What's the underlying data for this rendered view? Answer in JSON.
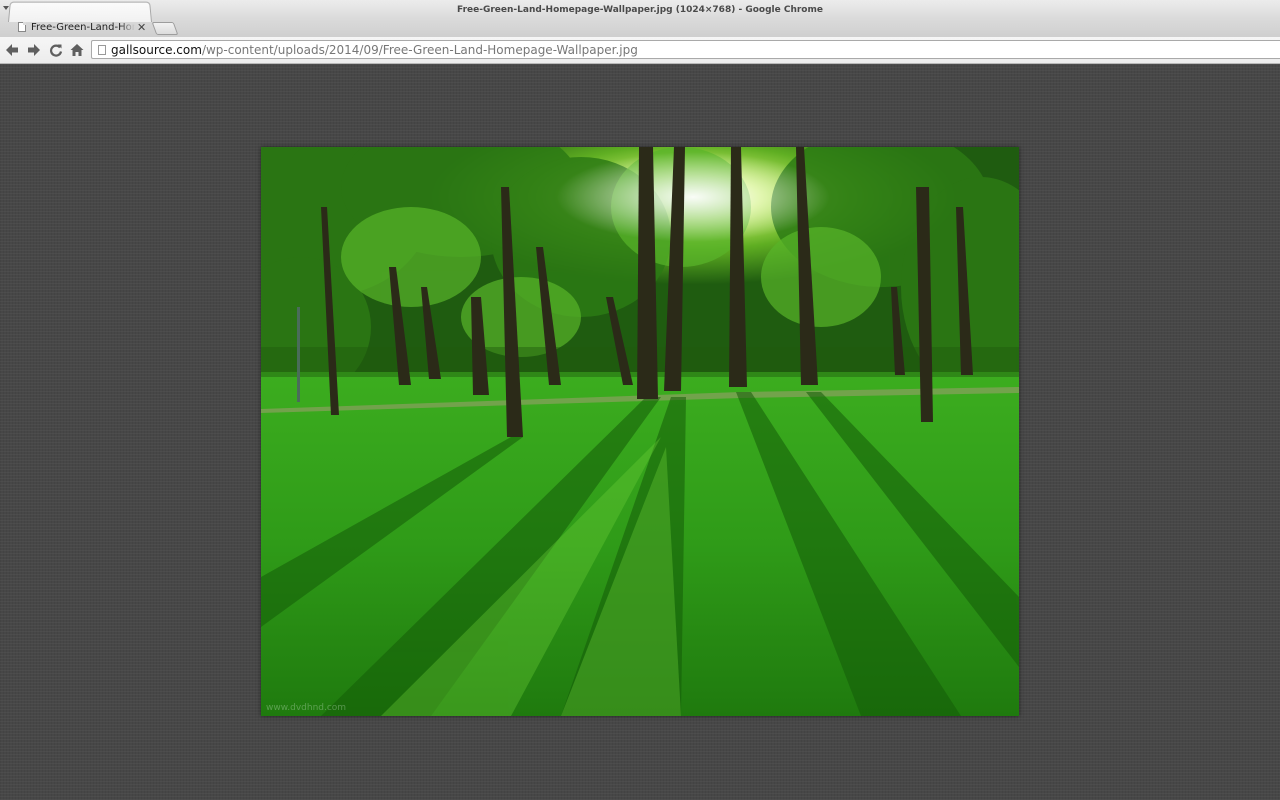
{
  "window": {
    "title": "Free-Green-Land-Homepage-Wallpaper.jpg (1024×768) - Google Chrome"
  },
  "tabs": [
    {
      "label": "Free-Green-Land-Homepage-Wallpaper.jpg",
      "active": true
    }
  ],
  "toolbar": {
    "back_icon": "arrow-left-icon",
    "forward_icon": "arrow-right-icon",
    "reload_icon": "reload-icon",
    "home_icon": "home-icon"
  },
  "omnibox": {
    "host": "gallsource.com",
    "path": "/wp-content/uploads/2014/09/Free-Green-Land-Homepage-Wallpaper.jpg"
  },
  "image": {
    "watermark": "www.dvdhnd.com",
    "scene": "sunlit park with trees and green lawn"
  },
  "colors": {
    "grass": "#2fa81f",
    "foliage": "#3c8f1e",
    "background": "#474747"
  }
}
